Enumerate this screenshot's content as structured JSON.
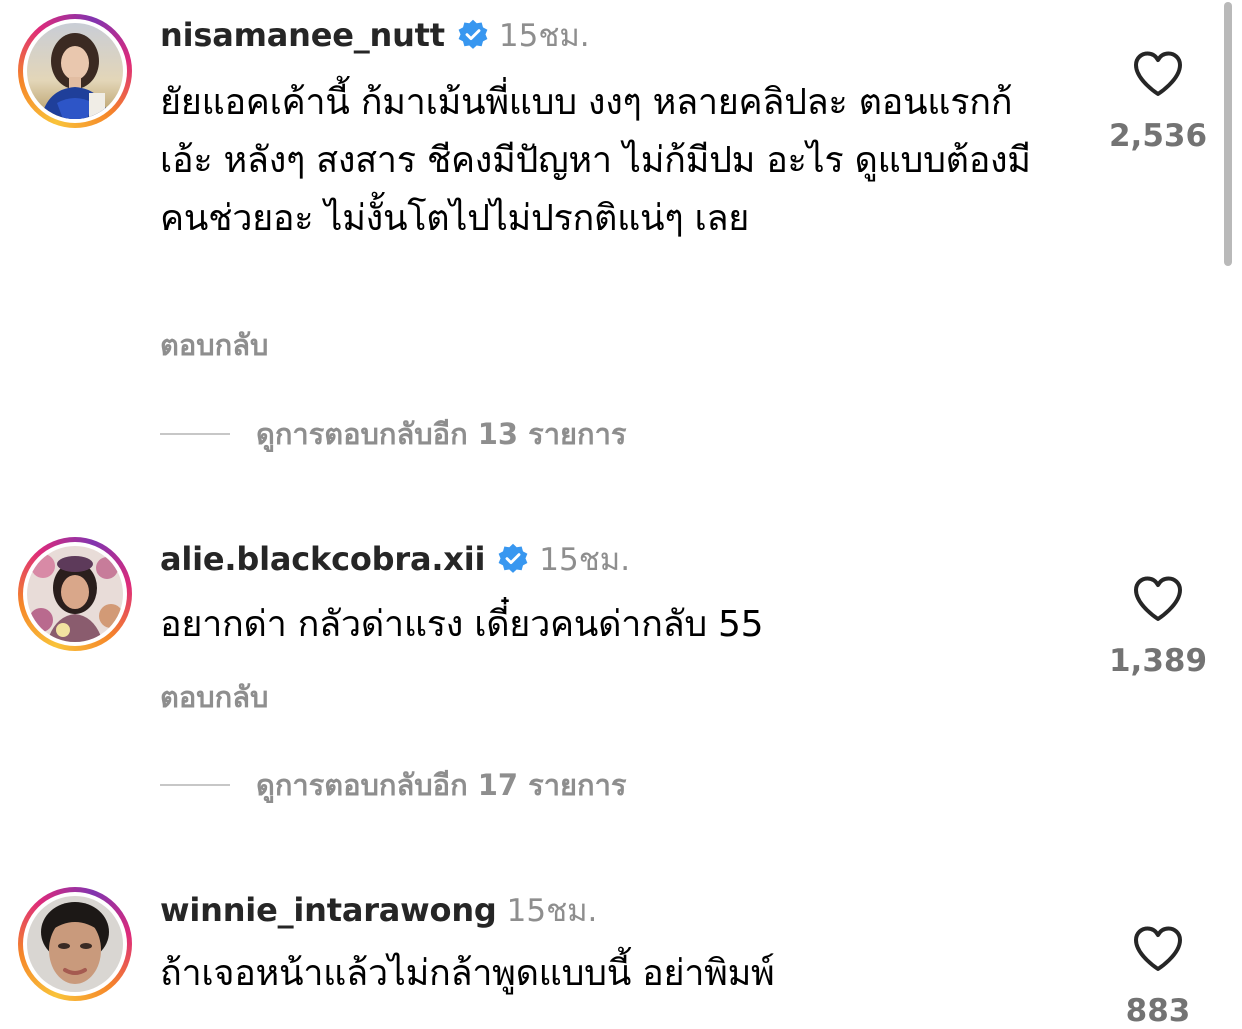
{
  "colors": {
    "primary_text": "#000000",
    "username": "#262626",
    "secondary_text": "#8e8e8e",
    "verified_badge": "#3897f0",
    "ring_gradient": [
      "#f9c33a",
      "#f58529",
      "#dd2a7b",
      "#8134af"
    ]
  },
  "comments": [
    {
      "username": "nisamanee_nutt",
      "verified": true,
      "time": "15ชม.",
      "text": "ยัยแอคเค้านี้ ก้มาเม้นพี่แบบ งงๆ หลายคลิปละ ตอนแรกก้ เอ้ะ หลังๆ สงสาร ชีคงมีปัญหา ไม่ก้มีปม อะไร ดูแบบต้องมีคนช่วยอะ ไม่งั้นโตไปไม่ปรกติแน่ๆ เลย",
      "reply_label": "ตอบกลับ",
      "view_replies": "ดูการตอบกลับอีก 13 รายการ",
      "likes": "2,536",
      "avatar_icon": "avatar-image"
    },
    {
      "username": "alie.blackcobra.xii",
      "verified": true,
      "time": "15ชม.",
      "text": "อยากด่า กลัวด่าแรง เดี๋ยวคนด่ากลับ 55",
      "reply_label": "ตอบกลับ",
      "view_replies": "ดูการตอบกลับอีก 17 รายการ",
      "likes": "1,389",
      "avatar_icon": "avatar-image"
    },
    {
      "username": "winnie_intarawong",
      "verified": false,
      "time": "15ชม.",
      "text": "ถ้าเจอหน้าแล้วไม่กล้าพูดแบบนี้ อย่าพิมพ์",
      "likes": "883",
      "avatar_icon": "avatar-image"
    }
  ]
}
